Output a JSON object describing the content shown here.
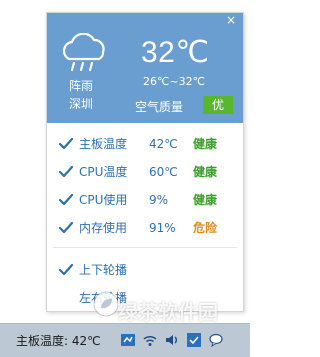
{
  "weather": {
    "description": "阵雨",
    "city": "深圳",
    "temperature": "32℃",
    "range": "26℃~32℃",
    "air_quality_label": "空气质量",
    "air_quality_value": "优",
    "icon": "cloud-rain-icon",
    "background_color": "#6a9ed0",
    "aq_badge_color": "#58b72e"
  },
  "close_label": "×",
  "stats": [
    {
      "label": "主板温度",
      "value": "42℃",
      "status": "健康"
    },
    {
      "label": "CPU温度",
      "value": "60℃",
      "status": "健康"
    },
    {
      "label": "CPU使用",
      "value": "9%",
      "status": "健康"
    },
    {
      "label": "内存使用",
      "value": "91%",
      "status": "危险"
    }
  ],
  "options": [
    {
      "label": "上下轮播"
    },
    {
      "label": "左右轮播"
    }
  ],
  "taskbar": {
    "text": "主板温度: 42℃"
  },
  "watermark": "绿茶软件园",
  "colors": {
    "accent_blue": "#2c6fb3",
    "healthy_green": "#3c9e2a",
    "danger_orange": "#e08a1e"
  }
}
